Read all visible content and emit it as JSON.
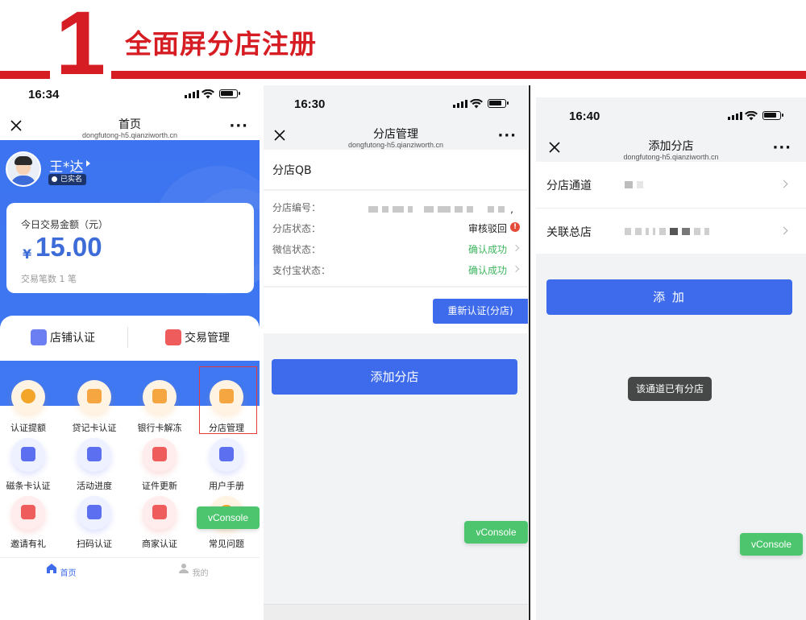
{
  "header": {
    "number": "1",
    "title": "全面屏分店注册"
  },
  "phone1": {
    "status_time": "16:34",
    "nav_title": "首页",
    "nav_url": "dongfutong-h5.qianziworth.cn",
    "user_name": "王*达",
    "verified_badge": "已实名",
    "today_label": "今日交易金额（元）",
    "currency_symbol": "¥",
    "today_amount": "15.00",
    "tx_count": "交易笔数 1 笔",
    "quick_actions": [
      "店铺认证",
      "交易管理"
    ],
    "grid": [
      {
        "label": "认证提额",
        "icon": "yen-coin-icon"
      },
      {
        "label": "贷记卡认证",
        "icon": "credit-card-icon"
      },
      {
        "label": "银行卡解冻",
        "icon": "bank-card-icon"
      },
      {
        "label": "分店管理",
        "icon": "store-icon"
      },
      {
        "label": "磁条卡认证",
        "icon": "magstripe-card-icon"
      },
      {
        "label": "活动进度",
        "icon": "bookmark-star-icon"
      },
      {
        "label": "证件更新",
        "icon": "id-card-icon"
      },
      {
        "label": "用户手册",
        "icon": "manual-icon"
      },
      {
        "label": "邀请有礼",
        "icon": "gift-mail-icon"
      },
      {
        "label": "扫码认证",
        "icon": "scan-doc-icon"
      },
      {
        "label": "商家认证",
        "icon": "shield-check-icon"
      },
      {
        "label": "常见问题",
        "icon": "question-icon"
      }
    ],
    "tabs": [
      "首页",
      "我的"
    ],
    "vconsole": "vConsole"
  },
  "phone2": {
    "status_time": "16:30",
    "nav_title": "分店管理",
    "nav_url": "dongfutong-h5.qianziworth.cn",
    "store_name": "分店QB",
    "rows": {
      "code_label": "分店编号：",
      "code_suffix": ",",
      "status_label": "分店状态：",
      "status_value": "审核驳回",
      "error_mark": "!",
      "wechat_label": "微信状态：",
      "wechat_value": "确认成功",
      "alipay_label": "支付宝状态：",
      "alipay_value": "确认成功"
    },
    "recert_button": "重新认证(分店)",
    "add_button": "添加分店",
    "vconsole": "vConsole"
  },
  "phone3": {
    "status_time": "16:40",
    "nav_title": "添加分店",
    "nav_url": "dongfutong-h5.qianziworth.cn",
    "channel_label": "分店通道",
    "parent_label": "关联总店",
    "add_button": "添 加",
    "toast": "该通道已有分店",
    "vconsole": "vConsole"
  },
  "colors": {
    "brand_red": "#d51d23",
    "primary_blue": "#3d6bec",
    "success_green": "#3cb55e",
    "vconsole_green": "#4cc56e"
  }
}
